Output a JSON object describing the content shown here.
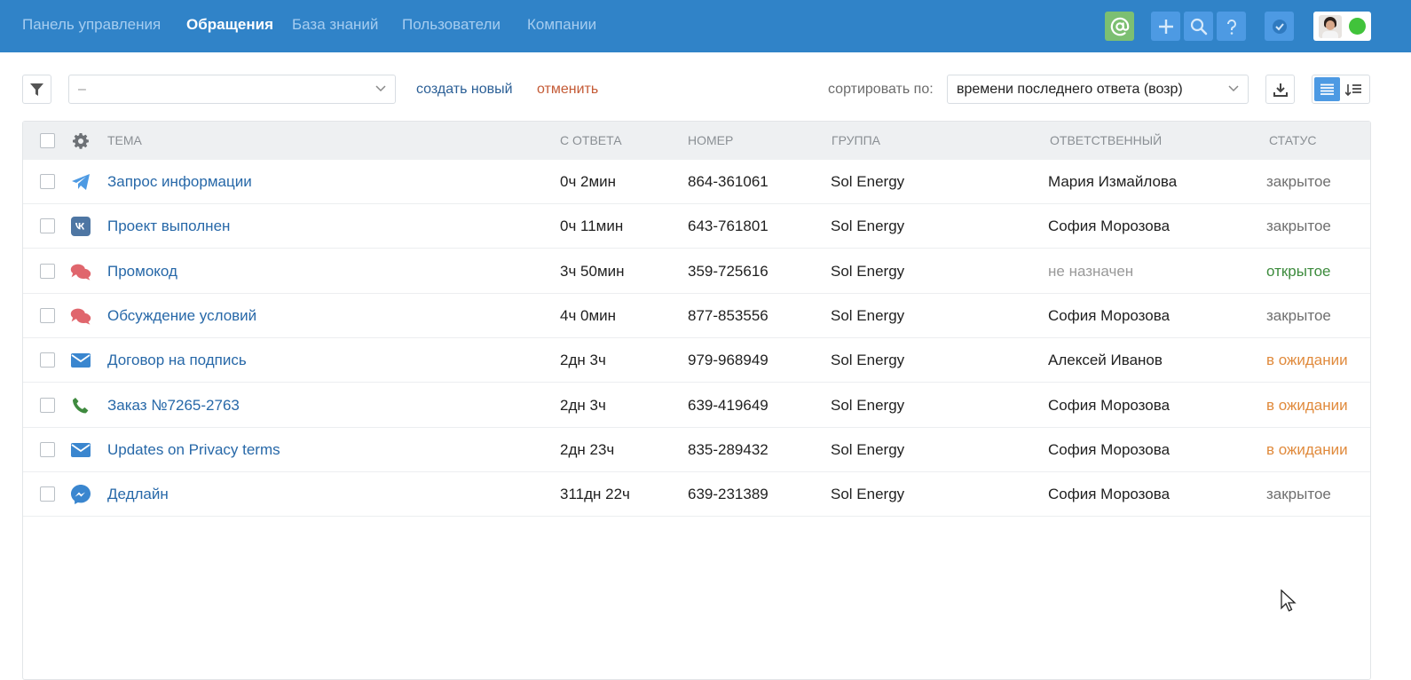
{
  "nav": {
    "items": [
      "Панель управления",
      "Обращения",
      "База знаний",
      "Пользователи",
      "Компании"
    ],
    "active_index": 1,
    "icons": [
      "at-icon",
      "plus-icon",
      "search-icon",
      "question-icon",
      "check-circle-icon"
    ]
  },
  "toolbar": {
    "filter_value": "–",
    "create_label": "создать новый",
    "cancel_label": "отменить",
    "sort_label": "сортировать по:",
    "sort_value": "времени последнего ответа (возр)"
  },
  "table": {
    "headers": {
      "subject": "ТЕМА",
      "since_reply": "С ОТВЕТА",
      "number": "НОМЕР",
      "group": "ГРУППА",
      "assignee": "ОТВЕТСТВЕННЫЙ",
      "status": "СТАТУС"
    },
    "rows": [
      {
        "channel": "telegram-icon",
        "subject": "Запрос информации",
        "since_reply": "0ч 2мин",
        "number": "864-361061",
        "group": "Sol Energy",
        "assignee": "Мария Измайлова",
        "status": "закрытое",
        "status_type": "closed",
        "unassigned": false
      },
      {
        "channel": "vk-icon",
        "subject": "Проект выполнен",
        "since_reply": "0ч 11мин",
        "number": "643-761801",
        "group": "Sol Energy",
        "assignee": "София Морозова",
        "status": "закрытое",
        "status_type": "closed",
        "unassigned": false
      },
      {
        "channel": "chat-icon",
        "subject": "Промокод",
        "since_reply": "3ч 50мин",
        "number": "359-725616",
        "group": "Sol Energy",
        "assignee": "не назначен",
        "status": "открытое",
        "status_type": "open",
        "unassigned": true
      },
      {
        "channel": "chat-icon",
        "subject": "Обсуждение условий",
        "since_reply": "4ч 0мин",
        "number": "877-853556",
        "group": "Sol Energy",
        "assignee": "София Морозова",
        "status": "закрытое",
        "status_type": "closed",
        "unassigned": false
      },
      {
        "channel": "email-icon",
        "subject": "Договор на подпись",
        "since_reply": "2дн 3ч",
        "number": "979-968949",
        "group": "Sol Energy",
        "assignee": "Алексей Иванов",
        "status": "в ожидании",
        "status_type": "waiting",
        "unassigned": false
      },
      {
        "channel": "phone-icon",
        "subject": "Заказ №7265-2763",
        "since_reply": "2дн 3ч",
        "number": "639-419649",
        "group": "Sol Energy",
        "assignee": "София Морозова",
        "status": "в ожидании",
        "status_type": "waiting",
        "unassigned": false
      },
      {
        "channel": "email-icon",
        "subject": "Updates on Privacy terms",
        "since_reply": "2дн 23ч",
        "number": "835-289432",
        "group": "Sol Energy",
        "assignee": "София Морозова",
        "status": "в ожидании",
        "status_type": "waiting",
        "unassigned": false
      },
      {
        "channel": "messenger-icon",
        "subject": "Дедлайн",
        "since_reply": "311дн 22ч",
        "number": "639-231389",
        "group": "Sol Energy",
        "assignee": "София Морозова",
        "status": "закрытое",
        "status_type": "closed",
        "unassigned": false
      }
    ]
  },
  "colors": {
    "navbar": "#3083c8",
    "link": "#2768a8",
    "status_closed": "#6f6f6f",
    "status_open": "#3d8b3d",
    "status_waiting": "#e08a3c"
  }
}
